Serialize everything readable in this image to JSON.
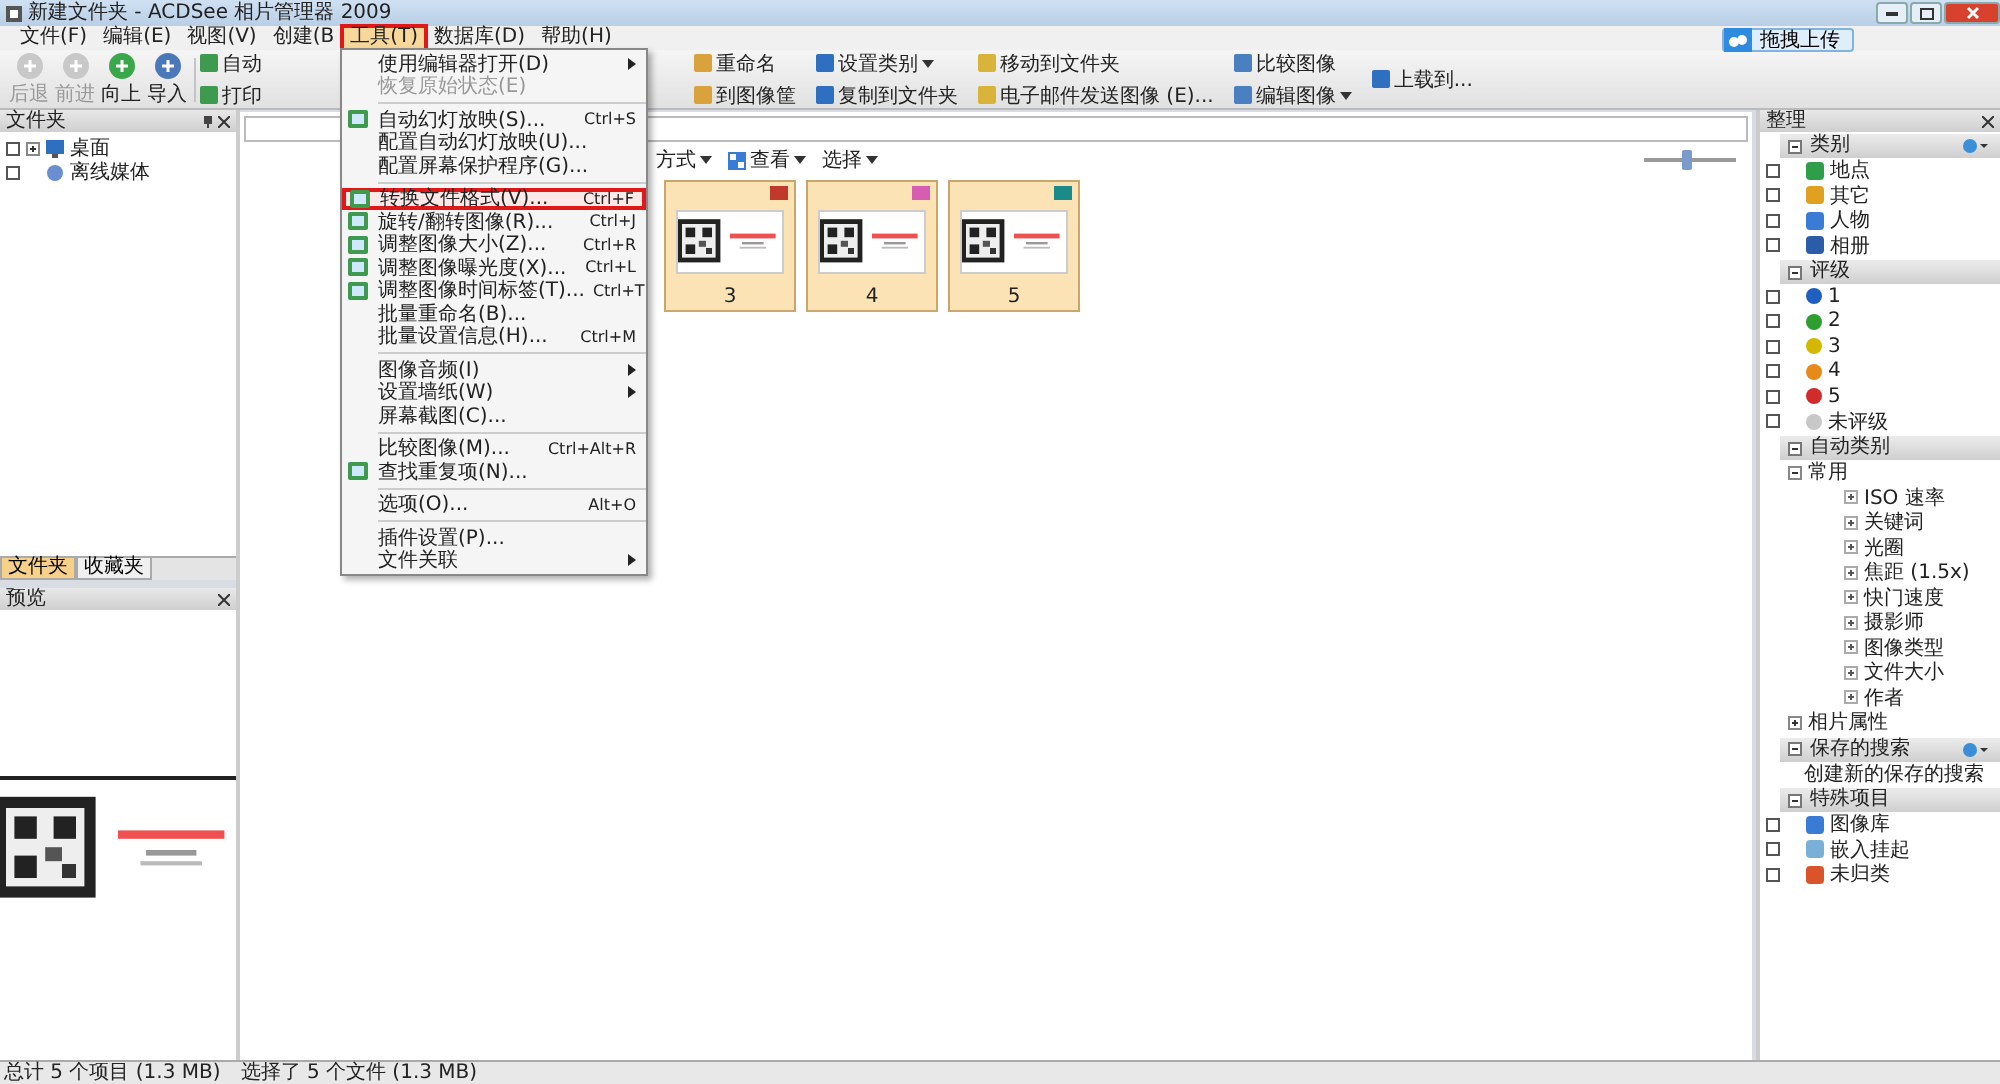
{
  "window": {
    "title": "新建文件夹 - ACDSee 相片管理器 2009"
  },
  "menubar": [
    {
      "label": "文件(F)",
      "selected": false,
      "highlighted": false
    },
    {
      "label": "编辑(E)",
      "selected": false,
      "highlighted": false
    },
    {
      "label": "视图(V)",
      "selected": false,
      "highlighted": false
    },
    {
      "label": "创建(B",
      "selected": false,
      "highlighted": false
    },
    {
      "label": "工具(T)",
      "selected": true,
      "highlighted": true
    },
    {
      "label": "数据库(D)",
      "selected": false,
      "highlighted": false
    },
    {
      "label": "帮助(H)",
      "selected": false,
      "highlighted": false
    }
  ],
  "upload_button": {
    "label": "拖拽上传"
  },
  "toolbar": {
    "nav": [
      {
        "label": "后退",
        "disabled": true
      },
      {
        "label": "前进",
        "disabled": true
      },
      {
        "label": "向上",
        "disabled": false
      },
      {
        "label": "导入",
        "disabled": false
      }
    ],
    "actions": [
      [
        {
          "label": "自动",
          "dropdown": false
        },
        {
          "label": "打印",
          "dropdown": false
        }
      ],
      [
        {
          "label": "重命名",
          "dropdown": false
        },
        {
          "label": "到图像筐",
          "dropdown": false
        }
      ],
      [
        {
          "label": "设置类别",
          "dropdown": true
        },
        {
          "label": "复制到文件夹",
          "dropdown": false
        }
      ],
      [
        {
          "label": "移动到文件夹",
          "dropdown": false
        },
        {
          "label": "电子邮件发送图像 (E)...",
          "dropdown": false
        }
      ],
      [
        {
          "label": "比较图像",
          "dropdown": false
        },
        {
          "label": "编辑图像",
          "dropdown": true
        }
      ],
      [
        {
          "label": "上载到...",
          "dropdown": false
        }
      ]
    ]
  },
  "tools_menu": [
    {
      "kind": "item",
      "label": "使用编辑器打开(D)",
      "submenu": true,
      "disabled": false,
      "icon": false,
      "highlighted": false
    },
    {
      "kind": "item",
      "label": "恢复原始状态(E)",
      "submenu": false,
      "disabled": true,
      "icon": false,
      "highlighted": false
    },
    {
      "kind": "separator"
    },
    {
      "kind": "item",
      "label": "自动幻灯放映(S)...",
      "shortcut": "Ctrl+S",
      "submenu": false,
      "disabled": false,
      "icon": true,
      "highlighted": false
    },
    {
      "kind": "item",
      "label": "配置自动幻灯放映(U)...",
      "submenu": false,
      "disabled": false,
      "icon": false,
      "highlighted": false
    },
    {
      "kind": "item",
      "label": "配置屏幕保护程序(G)...",
      "submenu": false,
      "disabled": false,
      "icon": false,
      "highlighted": false
    },
    {
      "kind": "separator"
    },
    {
      "kind": "item",
      "label": "转换文件格式(V)...",
      "shortcut": "Ctrl+F",
      "submenu": false,
      "disabled": false,
      "icon": true,
      "highlighted": true
    },
    {
      "kind": "item",
      "label": "旋转/翻转图像(R)...",
      "shortcut": "Ctrl+J",
      "submenu": false,
      "disabled": false,
      "icon": true,
      "highlighted": false
    },
    {
      "kind": "item",
      "label": "调整图像大小(Z)...",
      "shortcut": "Ctrl+R",
      "submenu": false,
      "disabled": false,
      "icon": true,
      "highlighted": false
    },
    {
      "kind": "item",
      "label": "调整图像曝光度(X)...",
      "shortcut": "Ctrl+L",
      "submenu": false,
      "disabled": false,
      "icon": true,
      "highlighted": false
    },
    {
      "kind": "item",
      "label": "调整图像时间标签(T)...",
      "shortcut": "Ctrl+T",
      "submenu": false,
      "disabled": false,
      "icon": true,
      "highlighted": false
    },
    {
      "kind": "item",
      "label": "批量重命名(B)...",
      "submenu": false,
      "disabled": false,
      "icon": false,
      "highlighted": false
    },
    {
      "kind": "item",
      "label": "批量设置信息(H)...",
      "shortcut": "Ctrl+M",
      "submenu": false,
      "disabled": false,
      "icon": false,
      "highlighted": false
    },
    {
      "kind": "separator"
    },
    {
      "kind": "item",
      "label": "图像音频(I)",
      "submenu": true,
      "disabled": false,
      "icon": false,
      "highlighted": false
    },
    {
      "kind": "item",
      "label": "设置墙纸(W)",
      "submenu": true,
      "disabled": false,
      "icon": false,
      "highlighted": false
    },
    {
      "kind": "item",
      "label": "屏幕截图(C)...",
      "submenu": false,
      "disabled": false,
      "icon": false,
      "highlighted": false
    },
    {
      "kind": "separator"
    },
    {
      "kind": "item",
      "label": "比较图像(M)...",
      "shortcut": "Ctrl+Alt+R",
      "submenu": false,
      "disabled": false,
      "icon": false,
      "highlighted": false
    },
    {
      "kind": "item",
      "label": "查找重复项(N)...",
      "submenu": false,
      "disabled": false,
      "icon": true,
      "highlighted": false
    },
    {
      "kind": "separator"
    },
    {
      "kind": "item",
      "label": "选项(O)...",
      "shortcut": "Alt+O",
      "submenu": false,
      "disabled": false,
      "icon": false,
      "highlighted": false
    },
    {
      "kind": "separator"
    },
    {
      "kind": "item",
      "label": "插件设置(P)...",
      "submenu": false,
      "disabled": false,
      "icon": false,
      "highlighted": false
    },
    {
      "kind": "item",
      "label": "文件关联",
      "submenu": true,
      "disabled": false,
      "icon": false,
      "highlighted": false
    }
  ],
  "folders_panel": {
    "title": "文件夹",
    "tree": [
      {
        "label": "桌面",
        "checked": false,
        "expandable": true
      },
      {
        "label": "离线媒体",
        "checked": false,
        "expandable": false
      }
    ],
    "tabs": [
      {
        "label": "文件夹",
        "selected": true
      },
      {
        "label": "收藏夹",
        "selected": false
      }
    ]
  },
  "preview_panel": {
    "title": "预览"
  },
  "view_toolbar": [
    {
      "label": "方式",
      "dropdown": true
    },
    {
      "label": "查看",
      "dropdown": true
    },
    {
      "label": "选择",
      "dropdown": true
    }
  ],
  "zoom_slider": {
    "level": 0.45
  },
  "thumbnails": [
    {
      "label": "3",
      "selected": true,
      "color": "#c0392b"
    },
    {
      "label": "4",
      "selected": true,
      "color": "#d65db1"
    },
    {
      "label": "5",
      "selected": true,
      "color": "#1a8a8a"
    }
  ],
  "organize_panel": {
    "title": "整理",
    "categories": {
      "title": "类别",
      "items": [
        {
          "label": "地点",
          "checked": false,
          "color": "#2e9e4a"
        },
        {
          "label": "其它",
          "checked": false,
          "color": "#e0a020"
        },
        {
          "label": "人物",
          "checked": false,
          "color": "#3a7bd5"
        },
        {
          "label": "相册",
          "checked": false,
          "color": "#2a5caa"
        }
      ]
    },
    "ratings": {
      "title": "评级",
      "items": [
        {
          "label": "1",
          "checked": false,
          "color": "#1f5fbf"
        },
        {
          "label": "2",
          "checked": false,
          "color": "#2e9e2e"
        },
        {
          "label": "3",
          "checked": false,
          "color": "#d4b800"
        },
        {
          "label": "4",
          "checked": false,
          "color": "#e88a1a"
        },
        {
          "label": "5",
          "checked": false,
          "color": "#d22b2b"
        },
        {
          "label": "未评级",
          "checked": false,
          "color": "#c8c8c8"
        }
      ]
    },
    "auto_categories": {
      "title": "自动类别",
      "tree": [
        {
          "label": "常用",
          "expanded": true,
          "children": [
            {
              "label": "ISO 速率"
            },
            {
              "label": "关键词"
            },
            {
              "label": "光圈"
            },
            {
              "label": "焦距 (1.5x)"
            },
            {
              "label": "快门速度"
            },
            {
              "label": "摄影师"
            },
            {
              "label": "图像类型"
            },
            {
              "label": "文件大小"
            },
            {
              "label": "作者"
            }
          ]
        },
        {
          "label": "相片属性",
          "expanded": false
        }
      ]
    },
    "saved_searches": {
      "title": "保存的搜索",
      "items": [
        "创建新的保存的搜索"
      ]
    },
    "special_items": {
      "title": "特殊项目",
      "items": [
        {
          "label": "图像库",
          "checked": false,
          "color": "#3a7bd5"
        },
        {
          "label": "嵌入挂起",
          "checked": false,
          "color": "#7ab0d8"
        },
        {
          "label": "未归类",
          "checked": false,
          "color": "#d9542b"
        }
      ]
    }
  },
  "status_bar": [
    "总计 5 个项目 (1.3 MB)",
    "选择了 5 个文件 (1.3 MB)"
  ]
}
